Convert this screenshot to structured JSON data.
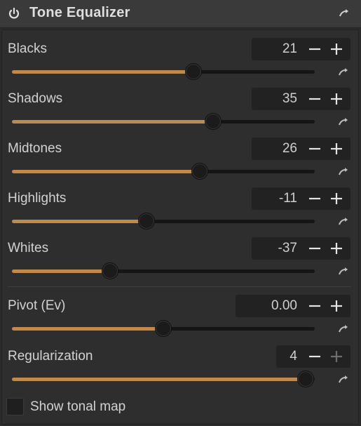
{
  "module": {
    "title": "Tone Equalizer",
    "enabled": true
  },
  "controls": [
    {
      "label": "Blacks",
      "value": "21",
      "level": 0.6
    },
    {
      "label": "Shadows",
      "value": "35",
      "level": 0.665
    },
    {
      "label": "Midtones",
      "value": "26",
      "level": 0.62
    },
    {
      "label": "Highlights",
      "value": "-11",
      "level": 0.445
    },
    {
      "label": "Whites",
      "value": "-37",
      "level": 0.325
    },
    {
      "label": "Pivot (Ev)",
      "value": "0.00",
      "level": 0.5
    },
    {
      "label": "Regularization",
      "value": "4",
      "level": 0.97
    }
  ],
  "show_tonal_map": {
    "label": "Show tonal map",
    "checked": false
  },
  "colors": {
    "accent": "#c08a4f",
    "background": "#2e2e2e",
    "header": "#3a3a3a"
  },
  "icons": {
    "power": "power-icon",
    "reset": "reset-icon",
    "minus": "minus-icon",
    "plus": "plus-icon"
  }
}
